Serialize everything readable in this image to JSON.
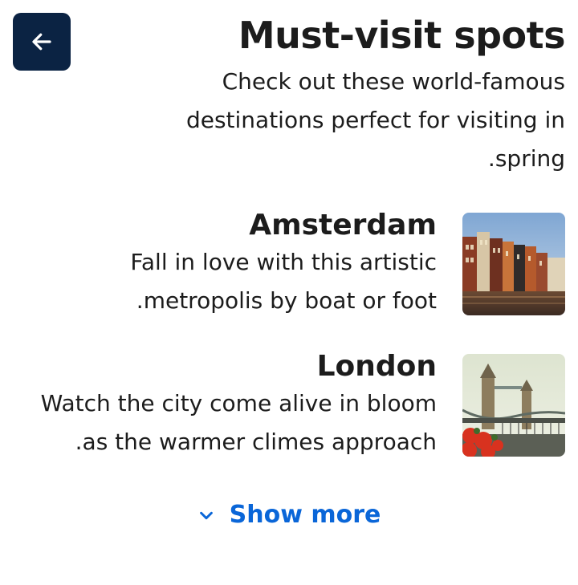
{
  "header": {
    "title": "Must-visit spots",
    "subtitle": "Check out these world-famous destinations perfect for visiting in spring."
  },
  "back_button": {
    "icon": "arrow-left-icon",
    "bg": "#0b2343"
  },
  "items": [
    {
      "title": "Amsterdam",
      "description": "Fall in love with this artistic metropolis by boat or foot.",
      "image": "amsterdam-canal-houses-photo"
    },
    {
      "title": "London",
      "description": "Watch the city come alive in bloom as the warmer climes approach.",
      "image": "london-tower-bridge-photo"
    }
  ],
  "show_more": {
    "label": "Show more",
    "icon": "chevron-down-icon",
    "color": "#0a66d8"
  }
}
